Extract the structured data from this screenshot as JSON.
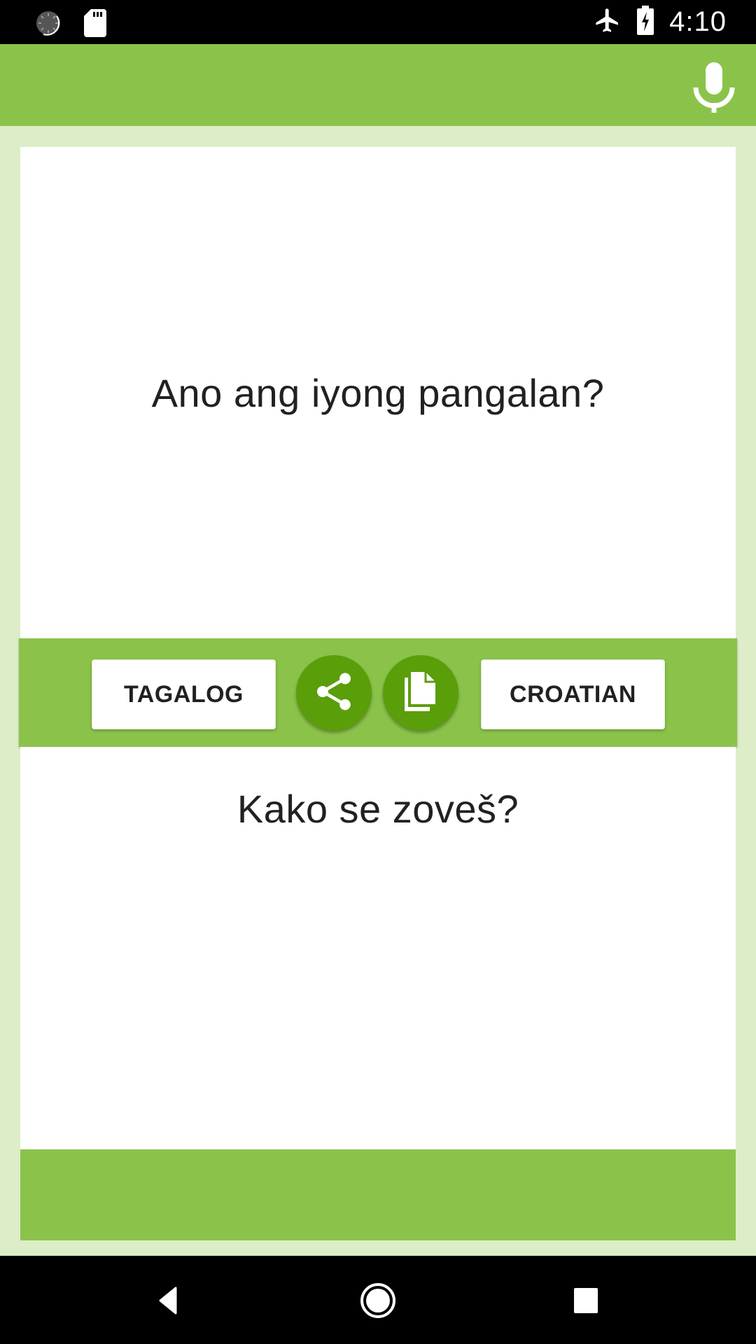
{
  "status_bar": {
    "time": "4:10",
    "left_icons": [
      "loading-circle-icon",
      "sd-card-icon"
    ],
    "right_icons": [
      "airplane-mode-icon",
      "battery-charging-icon"
    ]
  },
  "app_bar": {
    "actions": [
      {
        "icon": "microphone-icon",
        "label": "Voice input"
      }
    ]
  },
  "translation": {
    "source_text": "Ano ang iyong pangalan?",
    "target_text": "Kako se zoveš?"
  },
  "controls": {
    "source_language": "TAGALOG",
    "target_language": "CROATIAN",
    "share_icon": "share-icon",
    "copy_icon": "copy-icon"
  },
  "nav_bar": {
    "buttons": [
      "back",
      "home",
      "recents"
    ]
  },
  "colors": {
    "primary": "#8bc34a",
    "primary_dark": "#5a9e0a",
    "background": "#dcedc8",
    "text": "#212121"
  }
}
